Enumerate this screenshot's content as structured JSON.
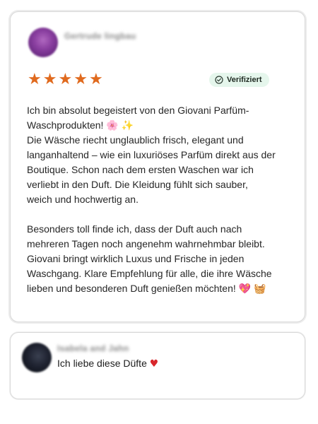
{
  "review": {
    "author_name": "Gertrude lingbau",
    "rating_stars": [
      "★",
      "★",
      "★",
      "★",
      "★"
    ],
    "rating": 5,
    "verified_label": "Verifiziert",
    "paragraph1_line1": "Ich bin absolut begeistert von den Giovani Parfüm-Waschprodukten! 🌸 ✨",
    "paragraph1_line2": "Die Wäsche riecht unglaublich frisch, elegant und langanhaltend – wie ein luxuriöses Parfüm direkt aus der Boutique. Schon nach dem ersten Waschen war ich verliebt in den Duft. Die Kleidung fühlt sich sauber, weich und hochwertig an.",
    "paragraph2": "Besonders toll finde ich, dass der Duft auch nach mehreren Tagen noch angenehm wahrnehmbar bleibt. Giovani bringt wirklich Luxus und Frische in jeden Waschgang. Klare Empfehlung für alle, die ihre Wäsche lieben und besonderen Duft genießen möchten! 💖 🧺"
  },
  "comment": {
    "author_name": "Isabela and Jahn",
    "text": "Ich liebe diese Düfte",
    "emoji": "♥"
  },
  "colors": {
    "star": "#e06a1e",
    "verified_bg": "#e5f6ec",
    "heart": "#d8262c"
  }
}
